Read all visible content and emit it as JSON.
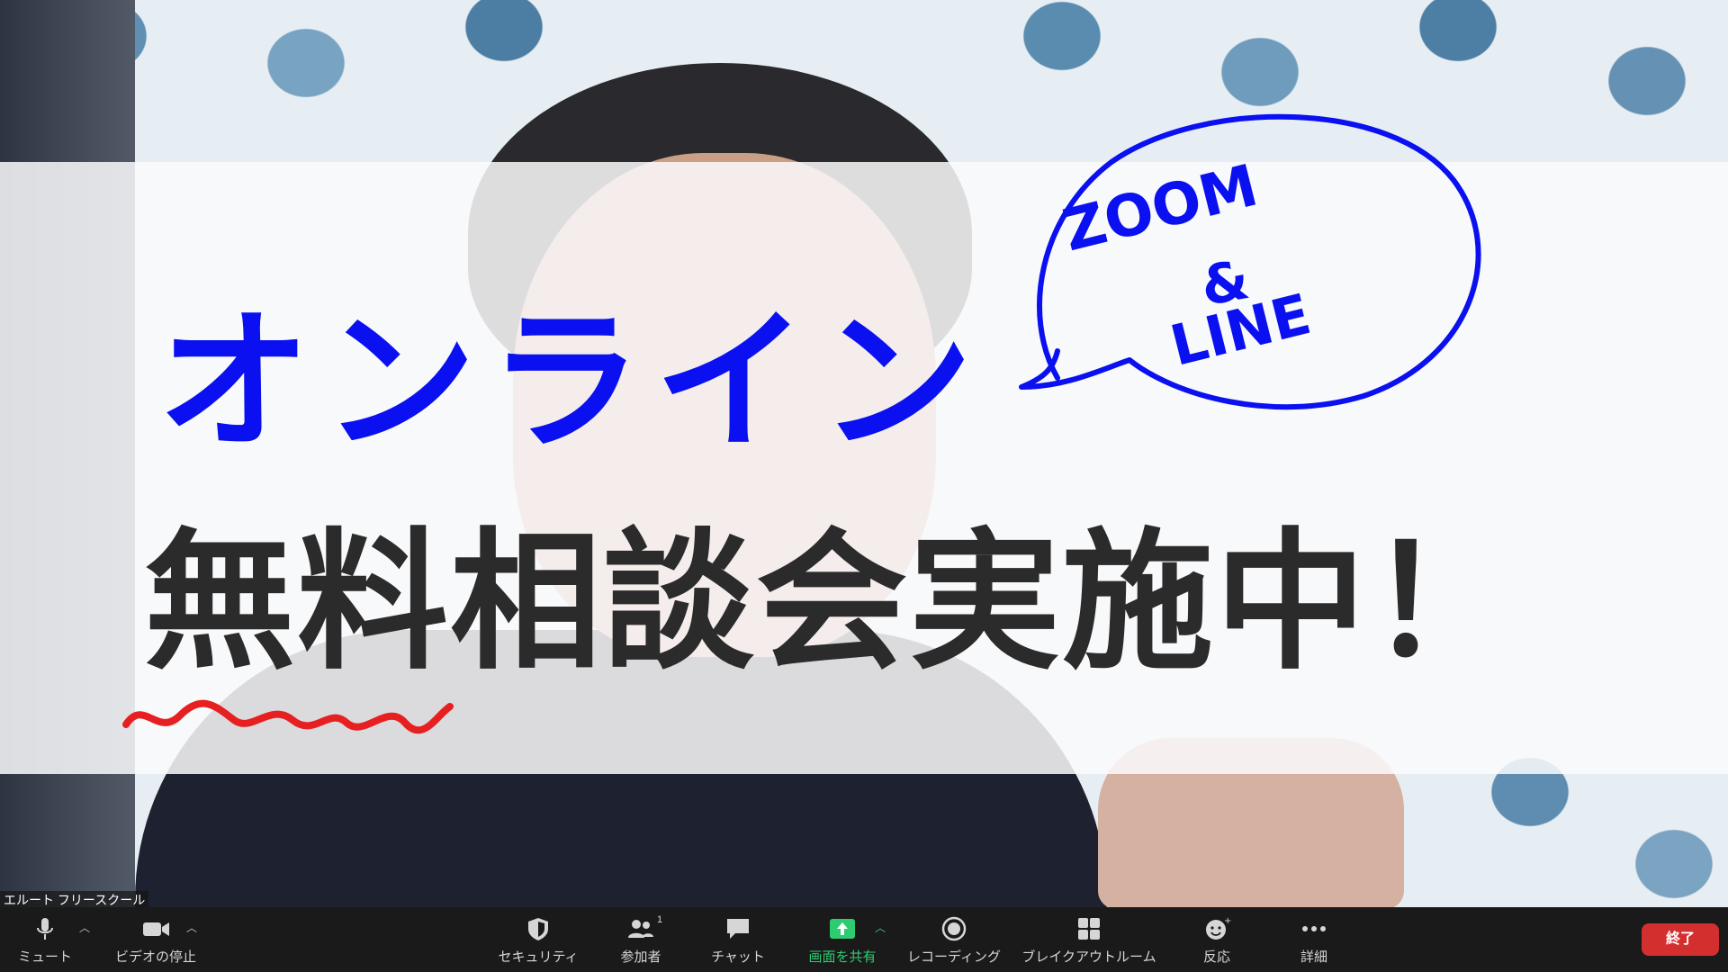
{
  "video": {
    "participant_name": "エルート フリースクール"
  },
  "banner": {
    "line1": "オンライン",
    "line2": "無料相談会実施中！",
    "bubble_line1": "ZOOM",
    "bubble_line2": "&",
    "bubble_line3": "LINE"
  },
  "toolbar": {
    "mute_label": "ミュート",
    "video_label": "ビデオの停止",
    "security_label": "セキュリティ",
    "participants_label": "参加者",
    "participants_count": "1",
    "chat_label": "チャット",
    "share_label": "画面を共有",
    "record_label": "レコーディング",
    "breakout_label": "ブレイクアウトルーム",
    "reactions_label": "反応",
    "more_label": "詳細",
    "end_label": "終了"
  },
  "colors": {
    "headline_blue": "#0a10f0",
    "headline_dark": "#2b2b2b",
    "squiggle_red": "#e62020",
    "toolbar_bg": "#1a1a1a",
    "share_green": "#2ecc71",
    "end_red": "#d42f2f"
  }
}
